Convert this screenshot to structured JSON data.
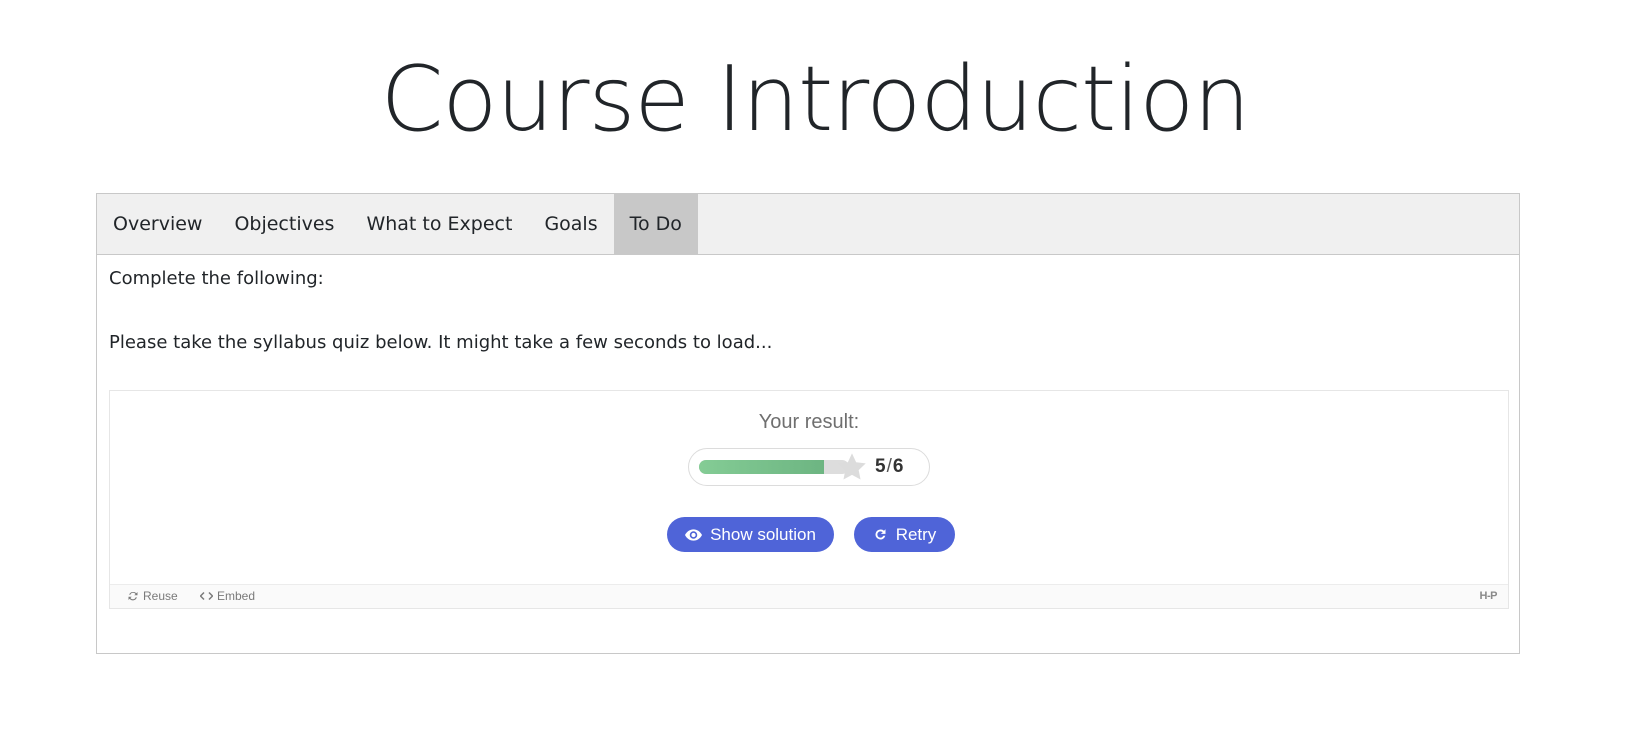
{
  "page": {
    "title": "Course Introduction"
  },
  "tabs": [
    {
      "label": "Overview"
    },
    {
      "label": "Objectives"
    },
    {
      "label": "What to Expect"
    },
    {
      "label": "Goals"
    },
    {
      "label": "To Do",
      "active": true
    }
  ],
  "content": {
    "line1": "Complete the following:",
    "line2": "Please take the syllabus quiz below. It might take a few seconds to load..."
  },
  "quiz": {
    "result_label": "Your result:",
    "score": 5,
    "max_score": 6,
    "score_separator": "/",
    "progress_fraction": 0.833,
    "show_solution_label": "Show solution",
    "retry_label": "Retry",
    "colors": {
      "button": "#4f64d8",
      "progress_fill": "#7cc28f",
      "progress_track": "#dddddd",
      "star": "#dcdcdc"
    }
  },
  "footer": {
    "reuse_label": "Reuse",
    "embed_label": "Embed",
    "logo_text": "H-P",
    "icons": [
      "reuse-icon",
      "embed-icon"
    ]
  }
}
